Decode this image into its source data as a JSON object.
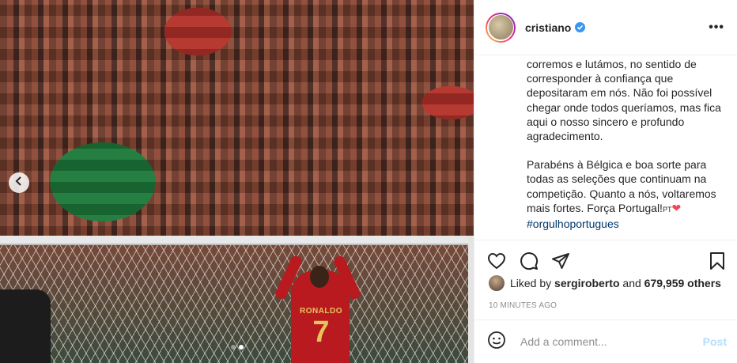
{
  "post": {
    "username": "cristiano",
    "more_label": "•••",
    "caption": {
      "paragraph1": "corremos e lutámos, no sentido de corresponder à confiança que depositaram em nós. Não foi possível chegar onde todos queríamos, mas fica aqui o nosso sincero e profundo agradecimento.",
      "paragraph2_text": "Parabéns à Bélgica e boa sorte para todas as seleções que continuam na competição. Quanto a nós, voltaremos mais fortes. Força Portugal!",
      "flag_label": "PT",
      "heart": "❤",
      "hashtag": "#orgulhoportugues"
    },
    "jersey": {
      "name": "RONALDO",
      "number": "7"
    },
    "likes": {
      "prefix": "Liked by",
      "user": "sergiroberto",
      "middle": "and",
      "count": "679,959 others"
    },
    "timestamp": "10 MINUTES AGO",
    "comment": {
      "placeholder": "Add a comment...",
      "post_label": "Post"
    },
    "carousel": {
      "prev_icon": "chevron-left-icon",
      "total": 2,
      "active": 2
    }
  },
  "colors": {
    "verified": "#3897f0",
    "heart": "#ed4956",
    "hashtag": "#00376b",
    "post_button": "#b2dffc",
    "muted": "#8e8e8e"
  }
}
